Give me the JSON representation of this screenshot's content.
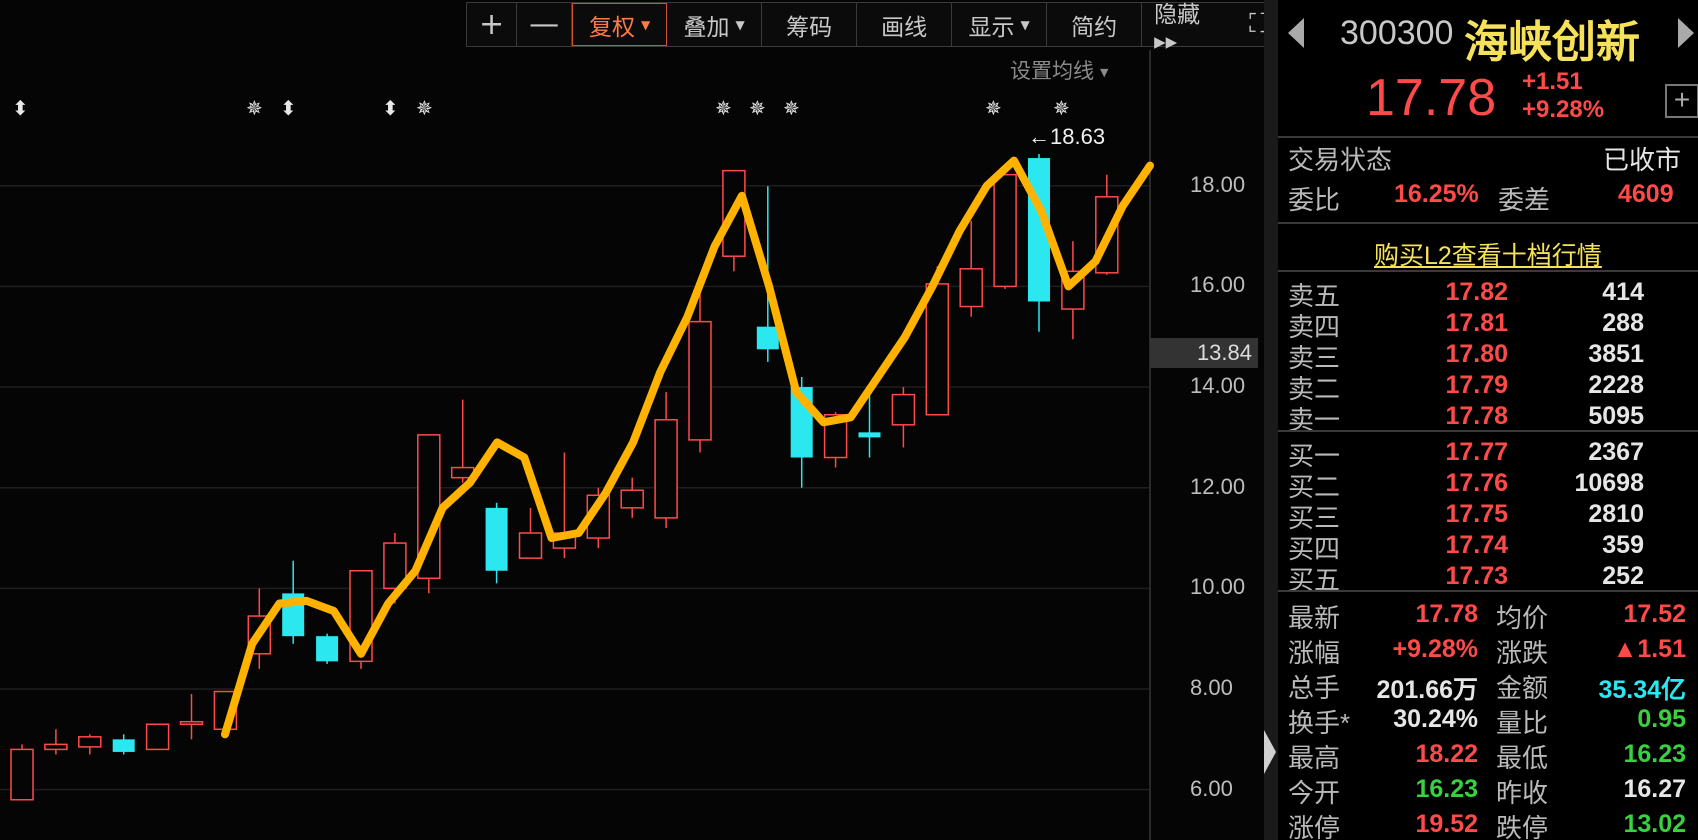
{
  "toolbar": {
    "plus": "+",
    "minus": "—",
    "items": [
      {
        "label": "复权",
        "caret": true,
        "active": true
      },
      {
        "label": "叠加",
        "caret": true,
        "active": false
      },
      {
        "label": "筹码",
        "caret": false,
        "active": false
      },
      {
        "label": "画线",
        "caret": false,
        "active": false
      },
      {
        "label": "显示",
        "caret": true,
        "active": false
      },
      {
        "label": "简约",
        "caret": false,
        "active": false
      },
      {
        "label": "隐藏 ▸▸",
        "caret": false,
        "active": false
      }
    ],
    "fullscreen": "⛶"
  },
  "ma_setting": "设置均线",
  "chart": {
    "y_ticks": [
      "18.00",
      "16.00",
      "14.00",
      "12.00",
      "10.00",
      "8.00",
      "6.00"
    ],
    "y_tick_values": [
      18,
      16,
      14,
      12,
      10,
      8,
      6
    ],
    "current_price_tag": "13.84",
    "high_label": "18.63",
    "markers": [
      "⬍",
      "✵",
      "⬍",
      "⬍",
      "✵",
      "✵",
      "✵",
      "✵",
      "✵",
      "✵"
    ]
  },
  "chart_data": {
    "type": "candlestick",
    "ylim": [
      5,
      20.3
    ],
    "candles": [
      {
        "o": 5.8,
        "c": 6.8,
        "h": 6.9,
        "l": 5.8
      },
      {
        "o": 6.8,
        "c": 6.9,
        "h": 7.2,
        "l": 6.7
      },
      {
        "o": 6.85,
        "c": 7.05,
        "h": 7.1,
        "l": 6.7
      },
      {
        "o": 7.0,
        "c": 6.75,
        "h": 7.1,
        "l": 6.7
      },
      {
        "o": 6.8,
        "c": 7.3,
        "h": 7.3,
        "l": 6.8
      },
      {
        "o": 7.3,
        "c": 7.35,
        "h": 7.9,
        "l": 7.0
      },
      {
        "o": 7.2,
        "c": 7.95,
        "h": 7.95,
        "l": 7.1
      },
      {
        "o": 8.7,
        "c": 9.45,
        "h": 10.0,
        "l": 8.4
      },
      {
        "o": 9.9,
        "c": 9.05,
        "h": 10.55,
        "l": 8.9
      },
      {
        "o": 9.05,
        "c": 8.55,
        "h": 9.1,
        "l": 8.5
      },
      {
        "o": 8.55,
        "c": 10.35,
        "h": 10.35,
        "l": 8.4
      },
      {
        "o": 10.0,
        "c": 10.9,
        "h": 11.1,
        "l": 9.7
      },
      {
        "o": 10.2,
        "c": 13.05,
        "h": 13.05,
        "l": 9.9
      },
      {
        "o": 12.2,
        "c": 12.4,
        "h": 13.75,
        "l": 12.1
      },
      {
        "o": 11.6,
        "c": 10.35,
        "h": 11.7,
        "l": 10.1
      },
      {
        "o": 10.6,
        "c": 11.1,
        "h": 11.6,
        "l": 10.6
      },
      {
        "o": 10.8,
        "c": 11.1,
        "h": 12.7,
        "l": 10.6
      },
      {
        "o": 11.0,
        "c": 11.85,
        "h": 12.0,
        "l": 10.8
      },
      {
        "o": 11.6,
        "c": 11.95,
        "h": 12.2,
        "l": 11.4
      },
      {
        "o": 11.4,
        "c": 13.35,
        "h": 13.9,
        "l": 11.2
      },
      {
        "o": 12.95,
        "c": 15.3,
        "h": 15.95,
        "l": 12.7
      },
      {
        "o": 16.6,
        "c": 18.3,
        "h": 18.3,
        "l": 16.3
      },
      {
        "o": 15.2,
        "c": 14.75,
        "h": 17.99,
        "l": 14.5
      },
      {
        "o": 14.0,
        "c": 12.6,
        "h": 14.2,
        "l": 12.0
      },
      {
        "o": 12.6,
        "c": 13.45,
        "h": 13.5,
        "l": 12.4
      },
      {
        "o": 13.1,
        "c": 13.0,
        "h": 14.0,
        "l": 12.6
      },
      {
        "o": 13.25,
        "c": 13.85,
        "h": 14.0,
        "l": 12.8
      },
      {
        "o": 13.45,
        "c": 16.05,
        "h": 16.4,
        "l": 13.45
      },
      {
        "o": 15.6,
        "c": 16.35,
        "h": 17.3,
        "l": 15.4
      },
      {
        "o": 16.0,
        "c": 18.22,
        "h": 18.22,
        "l": 15.95
      },
      {
        "o": 18.55,
        "c": 15.7,
        "h": 18.63,
        "l": 15.1
      },
      {
        "o": 15.55,
        "c": 16.3,
        "h": 16.9,
        "l": 14.95
      },
      {
        "o": 16.27,
        "c": 17.78,
        "h": 18.22,
        "l": 16.23
      }
    ],
    "ma_line": [
      7.1,
      8.9,
      9.7,
      9.75,
      9.55,
      8.7,
      9.7,
      10.35,
      11.6,
      12.1,
      12.9,
      12.6,
      11.0,
      11.1,
      11.9,
      12.9,
      14.3,
      15.4,
      16.8,
      17.8,
      16.0,
      13.9,
      13.3,
      13.4,
      14.2,
      15.0,
      16.0,
      17.1,
      18.0,
      18.5,
      17.5,
      16.0,
      16.5,
      17.6,
      18.4
    ]
  },
  "panel": {
    "code": "300300",
    "name": "海峡创新",
    "price": "17.78",
    "change": "+1.51",
    "change_pct": "+9.28%",
    "plus": "+",
    "trade_status_label": "交易状态",
    "trade_status_value": "已收市",
    "weibi_label": "委比",
    "weibi_value": "16.25%",
    "weicha_label": "委差",
    "weicha_value": "4609",
    "l2_link": "购买L2查看十档行情",
    "asks": [
      {
        "label": "卖五",
        "price": "17.82",
        "vol": "414"
      },
      {
        "label": "卖四",
        "price": "17.81",
        "vol": "288"
      },
      {
        "label": "卖三",
        "price": "17.80",
        "vol": "3851"
      },
      {
        "label": "卖二",
        "price": "17.79",
        "vol": "2228"
      },
      {
        "label": "卖一",
        "price": "17.78",
        "vol": "5095"
      }
    ],
    "bids": [
      {
        "label": "买一",
        "price": "17.77",
        "vol": "2367"
      },
      {
        "label": "买二",
        "price": "17.76",
        "vol": "10698"
      },
      {
        "label": "买三",
        "price": "17.75",
        "vol": "2810"
      },
      {
        "label": "买四",
        "price": "17.74",
        "vol": "359"
      },
      {
        "label": "买五",
        "price": "17.73",
        "vol": "252"
      }
    ],
    "stats": [
      {
        "k1": "最新",
        "v1": "17.78",
        "c1": "red",
        "k2": "均价",
        "v2": "17.52",
        "c2": "red"
      },
      {
        "k1": "涨幅",
        "v1": "+9.28%",
        "c1": "red",
        "k2": "涨跌",
        "v2": "▲1.51",
        "c2": "red"
      },
      {
        "k1": "总手",
        "v1": "201.66万",
        "c1": "white",
        "k2": "金额",
        "v2": "35.34亿",
        "c2": "cyan"
      },
      {
        "k1": "换手*",
        "v1": "30.24%",
        "c1": "white",
        "k2": "量比",
        "v2": "0.95",
        "c2": "green"
      },
      {
        "k1": "最高",
        "v1": "18.22",
        "c1": "red",
        "k2": "最低",
        "v2": "16.23",
        "c2": "green"
      },
      {
        "k1": "今开",
        "v1": "16.23",
        "c1": "green",
        "k2": "昨收",
        "v2": "16.27",
        "c2": "white"
      },
      {
        "k1": "涨停",
        "v1": "19.52",
        "c1": "red",
        "k2": "跌停",
        "v2": "13.02",
        "c2": "green"
      }
    ],
    "colors": {
      "up": "#ff4a4a",
      "down": "#2be8f0",
      "ma": "#ffb300",
      "name": "#f5e25a"
    }
  }
}
